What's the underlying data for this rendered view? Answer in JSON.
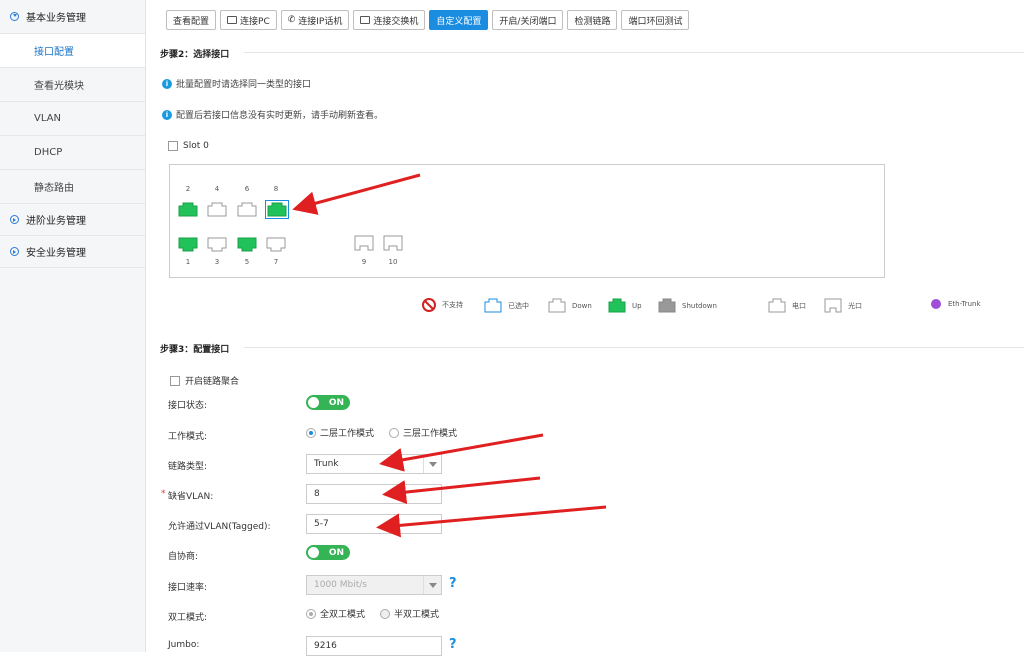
{
  "sidebar": {
    "group1": "基本业务管理",
    "items": [
      "接口配置",
      "查看光模块",
      "VLAN",
      "DHCP",
      "静态路由"
    ],
    "group2": "进阶业务管理",
    "group3": "安全业务管理"
  },
  "tabs": [
    "查看配置",
    "连接PC",
    "连接IP话机",
    "连接交换机",
    "自定义配置",
    "开启/关闭端口",
    "检测链路",
    "端口环回测试"
  ],
  "step2": {
    "title": "步骤2：选择接口",
    "info1": "批量配置时请选择同一类型的接口",
    "info2": "配置后若接口信息没有实时更新，请手动刷新查看。",
    "slot": "Slot 0",
    "top_ports": [
      "2",
      "4",
      "6",
      "8"
    ],
    "bottom_ports": [
      "1",
      "3",
      "5",
      "7"
    ],
    "optical_ports": [
      "9",
      "10"
    ]
  },
  "legend": {
    "unsupported": "不支持",
    "selected": "已选中",
    "down": "Down",
    "up": "Up",
    "shutdown": "Shutdown",
    "electrical": "电口",
    "optical": "光口",
    "eth_trunk": "Eth-Trunk"
  },
  "step3": {
    "title": "步骤3：配置接口",
    "link_agg": "开启链路聚合",
    "port_status_label": "接口状态:",
    "port_status": "ON",
    "work_mode_label": "工作模式:",
    "work_mode_l2": "二层工作模式",
    "work_mode_l3": "三层工作模式",
    "link_type_label": "链路类型:",
    "link_type": "Trunk",
    "default_vlan_label": "缺省VLAN:",
    "default_vlan": "8",
    "allowed_vlan_label": "允许通过VLAN(Tagged):",
    "allowed_vlan": "5-7",
    "autoneg_label": "自协商:",
    "autoneg": "ON",
    "speed_label": "接口速率:",
    "speed": "1000 Mbit/s",
    "duplex_label": "双工模式:",
    "duplex_full": "全双工模式",
    "duplex_half": "半双工模式",
    "jumbo_label": "Jumbo:",
    "jumbo": "9216",
    "help": "?"
  },
  "colors": {
    "up": "#22c25a",
    "accent": "#1a8de0",
    "arrow": "#e02020"
  }
}
